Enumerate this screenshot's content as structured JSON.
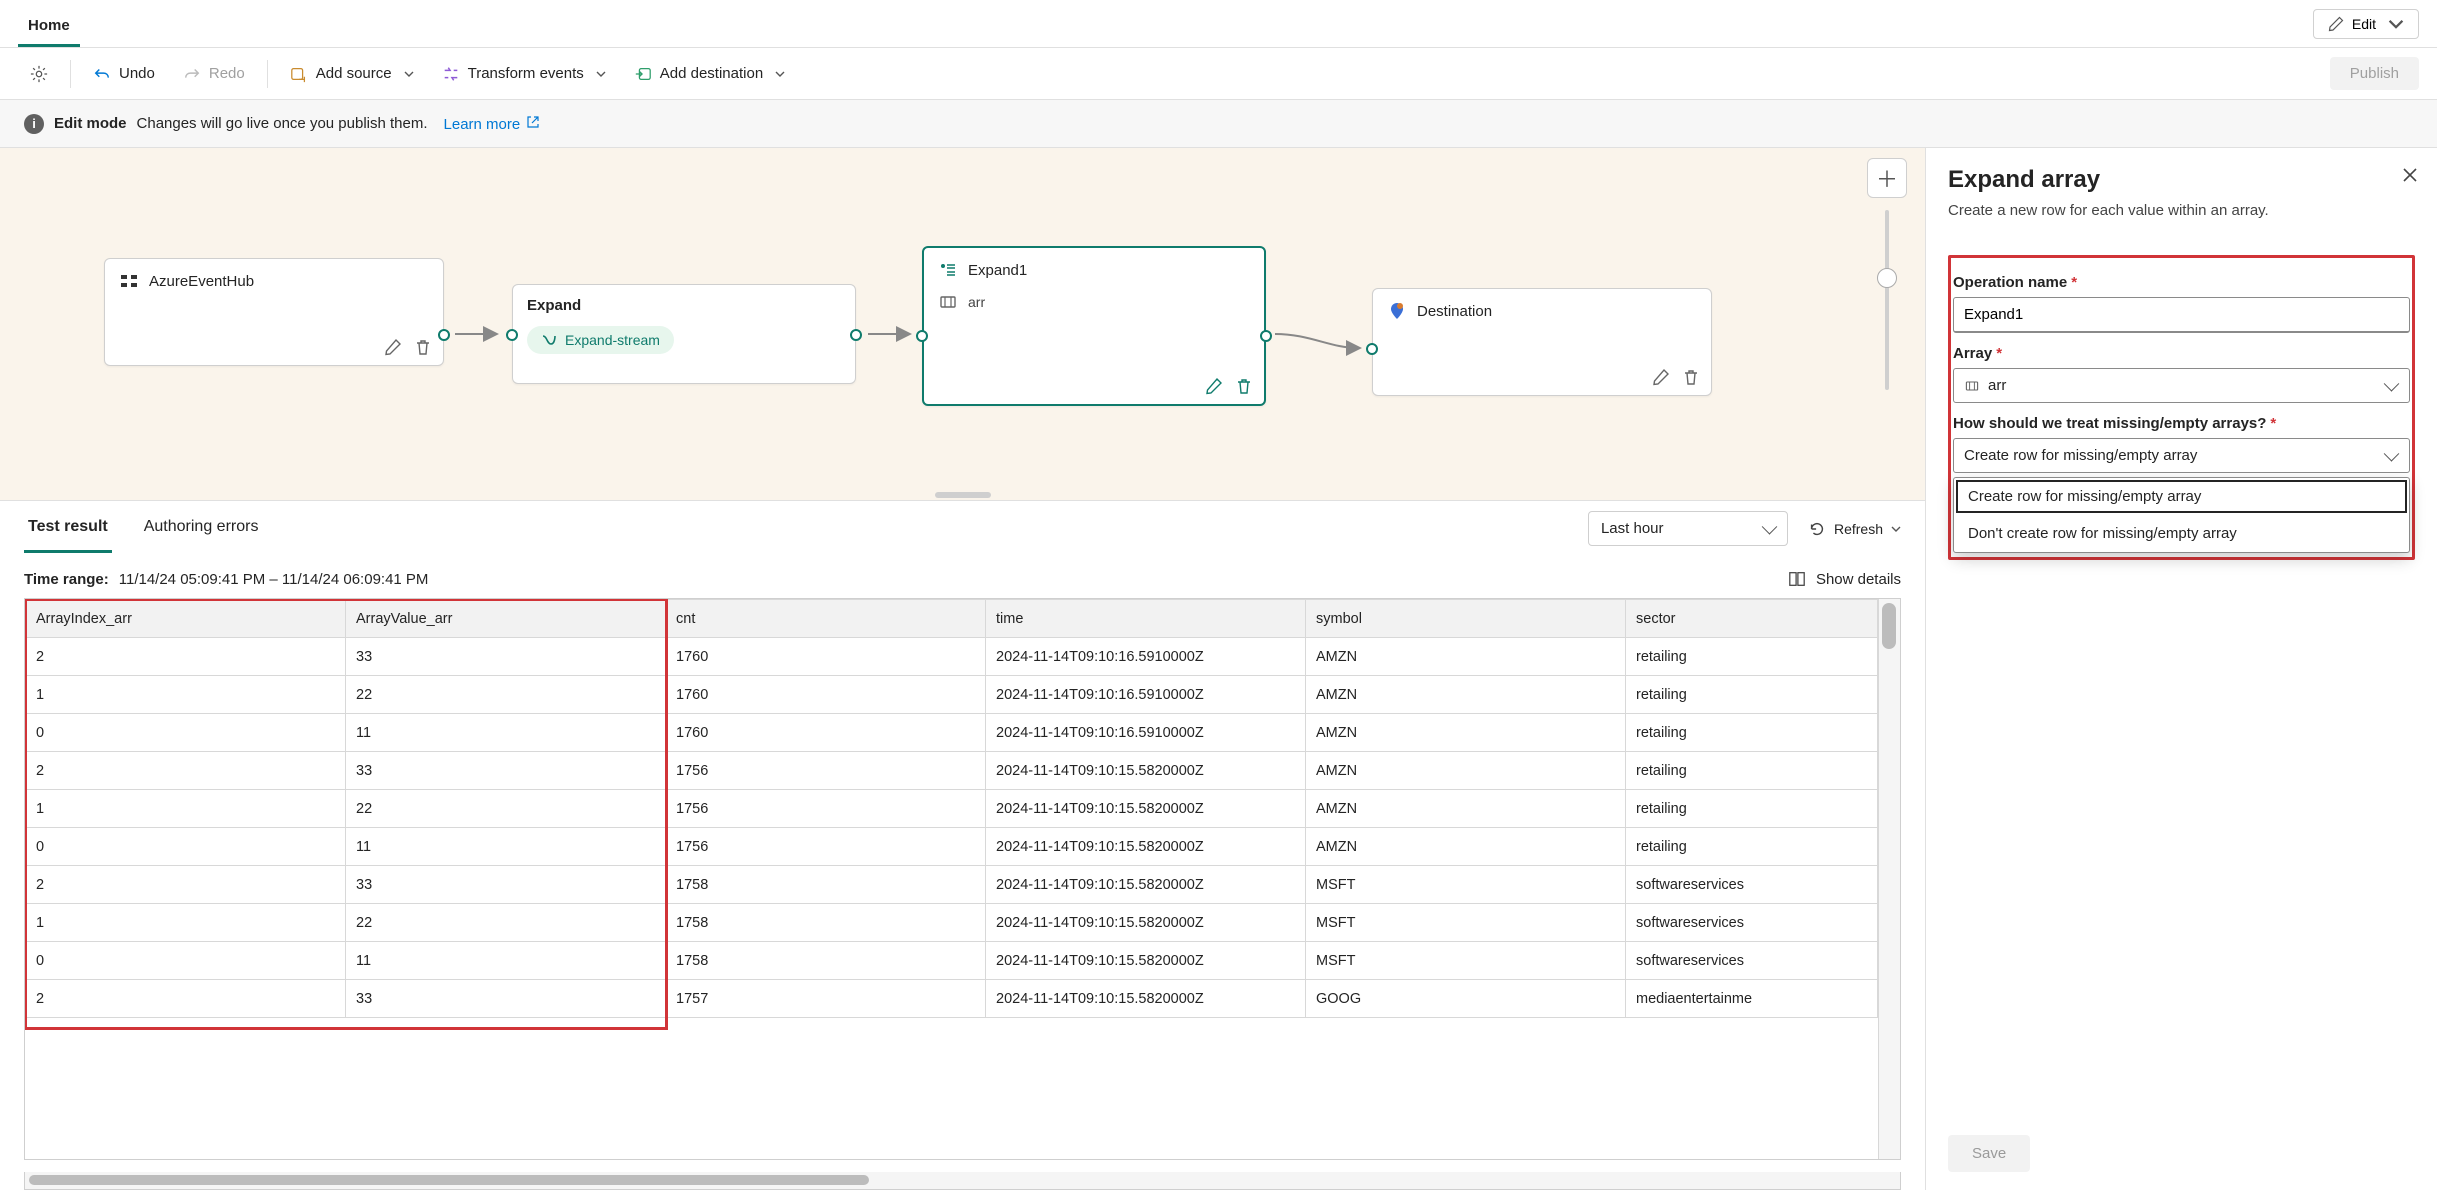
{
  "tabs": {
    "home": "Home"
  },
  "editBtn": "Edit",
  "toolbar": {
    "undo": "Undo",
    "redo": "Redo",
    "addSource": "Add source",
    "transform": "Transform events",
    "addDest": "Add destination",
    "publish": "Publish"
  },
  "infobar": {
    "mode": "Edit mode",
    "msg": "Changes will go live once you publish them.",
    "learn": "Learn more"
  },
  "nodes": {
    "source": {
      "title": "AzureEventHub"
    },
    "expand": {
      "title": "Expand",
      "pill": "Expand-stream"
    },
    "expand1": {
      "title": "Expand1",
      "sub": "arr"
    },
    "dest": {
      "title": "Destination"
    }
  },
  "resultTabs": {
    "test": "Test result",
    "errors": "Authoring errors"
  },
  "resultBar": {
    "lastHour": "Last hour",
    "refresh": "Refresh",
    "timeRangeLbl": "Time range:",
    "timeRange": "11/14/24 05:09:41 PM  –  11/14/24 06:09:41 PM",
    "showDetails": "Show details"
  },
  "columns": [
    "ArrayIndex_arr",
    "ArrayValue_arr",
    "cnt",
    "time",
    "symbol",
    "sector"
  ],
  "rows": [
    [
      "2",
      "33",
      "1760",
      "2024-11-14T09:10:16.5910000Z",
      "AMZN",
      "retailing"
    ],
    [
      "1",
      "22",
      "1760",
      "2024-11-14T09:10:16.5910000Z",
      "AMZN",
      "retailing"
    ],
    [
      "0",
      "11",
      "1760",
      "2024-11-14T09:10:16.5910000Z",
      "AMZN",
      "retailing"
    ],
    [
      "2",
      "33",
      "1756",
      "2024-11-14T09:10:15.5820000Z",
      "AMZN",
      "retailing"
    ],
    [
      "1",
      "22",
      "1756",
      "2024-11-14T09:10:15.5820000Z",
      "AMZN",
      "retailing"
    ],
    [
      "0",
      "11",
      "1756",
      "2024-11-14T09:10:15.5820000Z",
      "AMZN",
      "retailing"
    ],
    [
      "2",
      "33",
      "1758",
      "2024-11-14T09:10:15.5820000Z",
      "MSFT",
      "softwareservices"
    ],
    [
      "1",
      "22",
      "1758",
      "2024-11-14T09:10:15.5820000Z",
      "MSFT",
      "softwareservices"
    ],
    [
      "0",
      "11",
      "1758",
      "2024-11-14T09:10:15.5820000Z",
      "MSFT",
      "softwareservices"
    ],
    [
      "2",
      "33",
      "1757",
      "2024-11-14T09:10:15.5820000Z",
      "GOOG",
      "mediaentertainme"
    ]
  ],
  "panel": {
    "title": "Expand array",
    "desc": "Create a new row for each value within an array.",
    "opNameLbl": "Operation name",
    "opName": "Expand1",
    "arrayLbl": "Array",
    "arrayVal": "arr",
    "missingLbl": "How should we treat missing/empty arrays?",
    "missingVal": "Create row for missing/empty array",
    "opt1": "Create row for missing/empty array",
    "opt2": "Don't create row for missing/empty array",
    "save": "Save"
  }
}
